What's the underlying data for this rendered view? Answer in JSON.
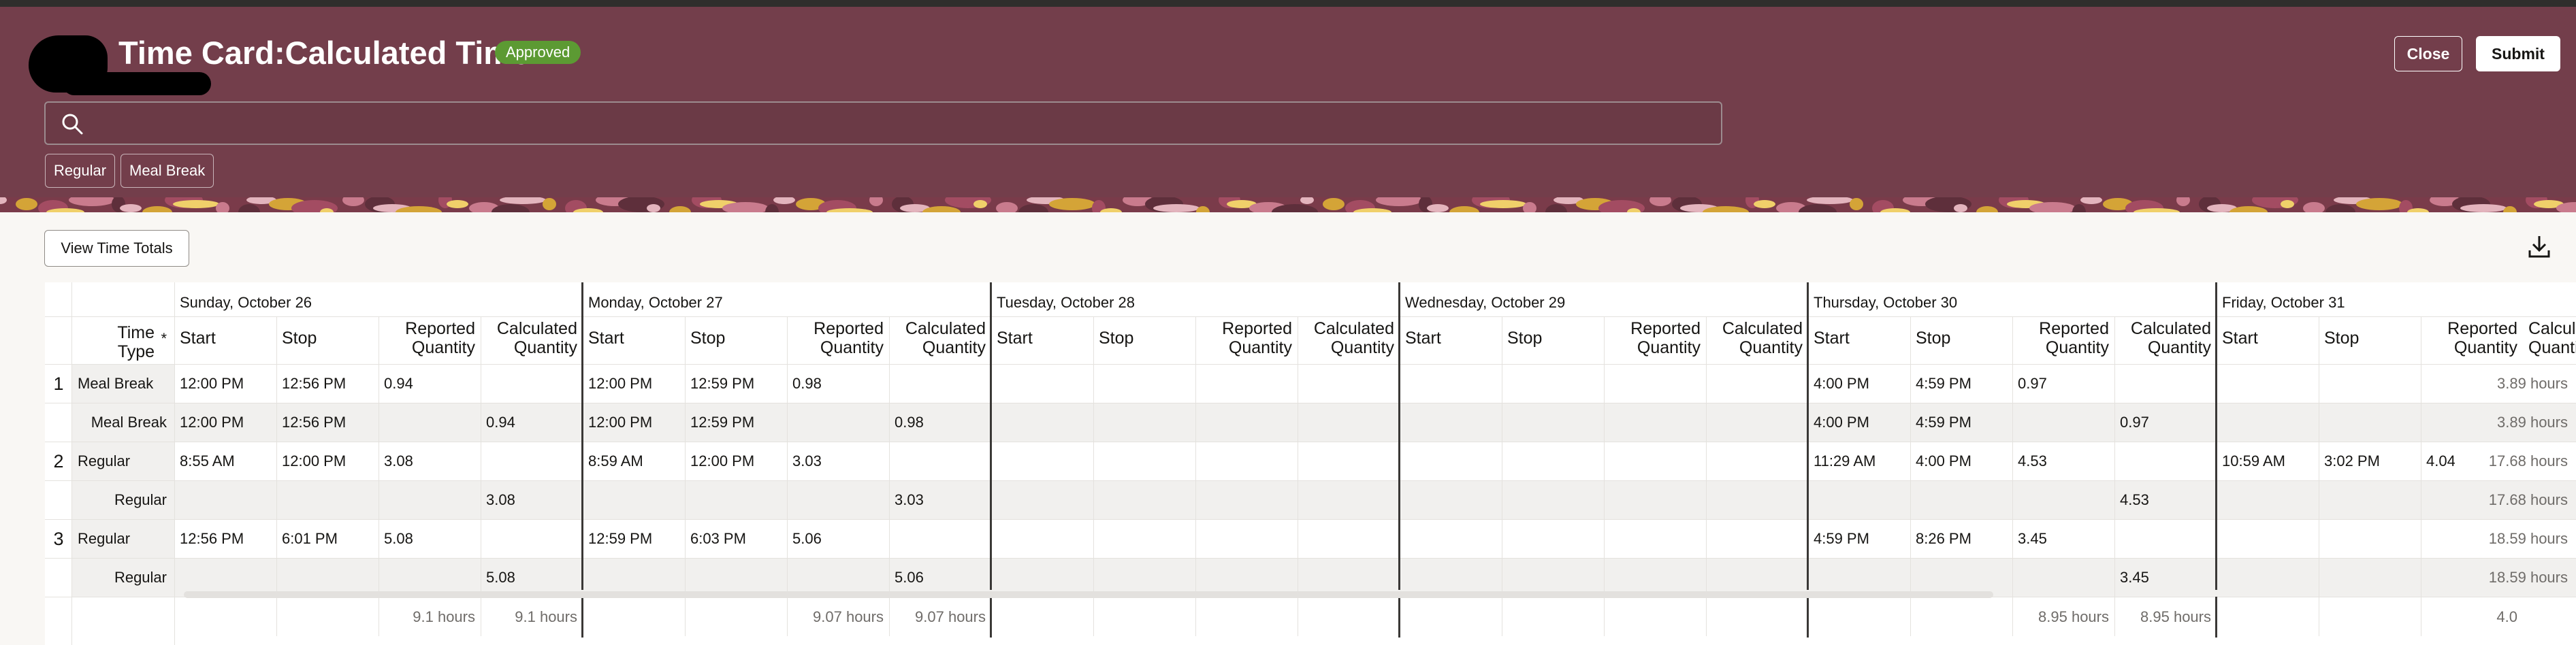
{
  "header": {
    "title": "Time Card:Calculated Time",
    "status_badge": "Approved",
    "close_label": "Close",
    "submit_label": "Submit",
    "search_placeholder": "",
    "chips": [
      "Regular",
      "Meal Break"
    ]
  },
  "toolbar": {
    "view_totals_label": "View Time Totals",
    "download_icon": "download-icon"
  },
  "table": {
    "time_type_header": "Time Type",
    "required_marker": "*",
    "days": [
      "Sunday, October 26",
      "Monday, October 27",
      "Tuesday, October 28",
      "Wednesday, October 29",
      "Thursday, October 30",
      "Friday, October 31"
    ],
    "columns": [
      "Start",
      "Stop",
      "Reported Quantity",
      "Calculated Quantity"
    ],
    "rows": [
      {
        "num": "1",
        "type": "Meal Break",
        "total": "3.89 hours",
        "cells": [
          [
            "12:00 PM",
            "12:56 PM",
            "0.94",
            ""
          ],
          [
            "12:00 PM",
            "12:59 PM",
            "0.98",
            ""
          ],
          [
            "",
            "",
            "",
            ""
          ],
          [
            "",
            "",
            "",
            ""
          ],
          [
            "4:00 PM",
            "4:59 PM",
            "0.97",
            ""
          ],
          [
            "",
            "",
            "",
            ""
          ]
        ]
      },
      {
        "num": "",
        "type": "Meal Break",
        "total": "3.89 hours",
        "cells": [
          [
            "12:00 PM",
            "12:56 PM",
            "",
            "0.94"
          ],
          [
            "12:00 PM",
            "12:59 PM",
            "",
            "0.98"
          ],
          [
            "",
            "",
            "",
            ""
          ],
          [
            "",
            "",
            "",
            ""
          ],
          [
            "4:00 PM",
            "4:59 PM",
            "",
            "0.97"
          ],
          [
            "",
            "",
            "",
            ""
          ]
        ]
      },
      {
        "num": "2",
        "type": "Regular",
        "total": "17.68 hours",
        "cells": [
          [
            "8:55 AM",
            "12:00 PM",
            "3.08",
            ""
          ],
          [
            "8:59 AM",
            "12:00 PM",
            "3.03",
            ""
          ],
          [
            "",
            "",
            "",
            ""
          ],
          [
            "",
            "",
            "",
            ""
          ],
          [
            "11:29 AM",
            "4:00 PM",
            "4.53",
            ""
          ],
          [
            "10:59 AM",
            "3:02 PM",
            "4.04",
            ""
          ]
        ]
      },
      {
        "num": "",
        "type": "Regular",
        "total": "17.68 hours",
        "cells": [
          [
            "",
            "",
            "",
            "3.08"
          ],
          [
            "",
            "",
            "",
            "3.03"
          ],
          [
            "",
            "",
            "",
            ""
          ],
          [
            "",
            "",
            "",
            ""
          ],
          [
            "",
            "",
            "",
            "4.53"
          ],
          [
            "",
            "",
            "",
            ""
          ]
        ]
      },
      {
        "num": "3",
        "type": "Regular",
        "total": "18.59 hours",
        "cells": [
          [
            "12:56 PM",
            "6:01 PM",
            "5.08",
            ""
          ],
          [
            "12:59 PM",
            "6:03 PM",
            "5.06",
            ""
          ],
          [
            "",
            "",
            "",
            ""
          ],
          [
            "",
            "",
            "",
            ""
          ],
          [
            "4:59 PM",
            "8:26 PM",
            "3.45",
            ""
          ],
          [
            "",
            "",
            "",
            ""
          ]
        ]
      },
      {
        "num": "",
        "type": "Regular",
        "total": "18.59 hours",
        "cells": [
          [
            "",
            "",
            "",
            "5.08"
          ],
          [
            "",
            "",
            "",
            "5.06"
          ],
          [
            "",
            "",
            "",
            ""
          ],
          [
            "",
            "",
            "",
            ""
          ],
          [
            "",
            "",
            "",
            "3.45"
          ],
          [
            "",
            "",
            "",
            ""
          ]
        ]
      }
    ],
    "footer": [
      [
        "",
        "",
        "9.1 hours",
        "9.1 hours"
      ],
      [
        "",
        "",
        "9.07 hours",
        "9.07 hours"
      ],
      [
        "",
        "",
        "",
        ""
      ],
      [
        "",
        "",
        "",
        ""
      ],
      [
        "",
        "",
        "8.95 hours",
        "8.95 hours"
      ],
      [
        "",
        "",
        "4.0",
        ""
      ]
    ]
  }
}
